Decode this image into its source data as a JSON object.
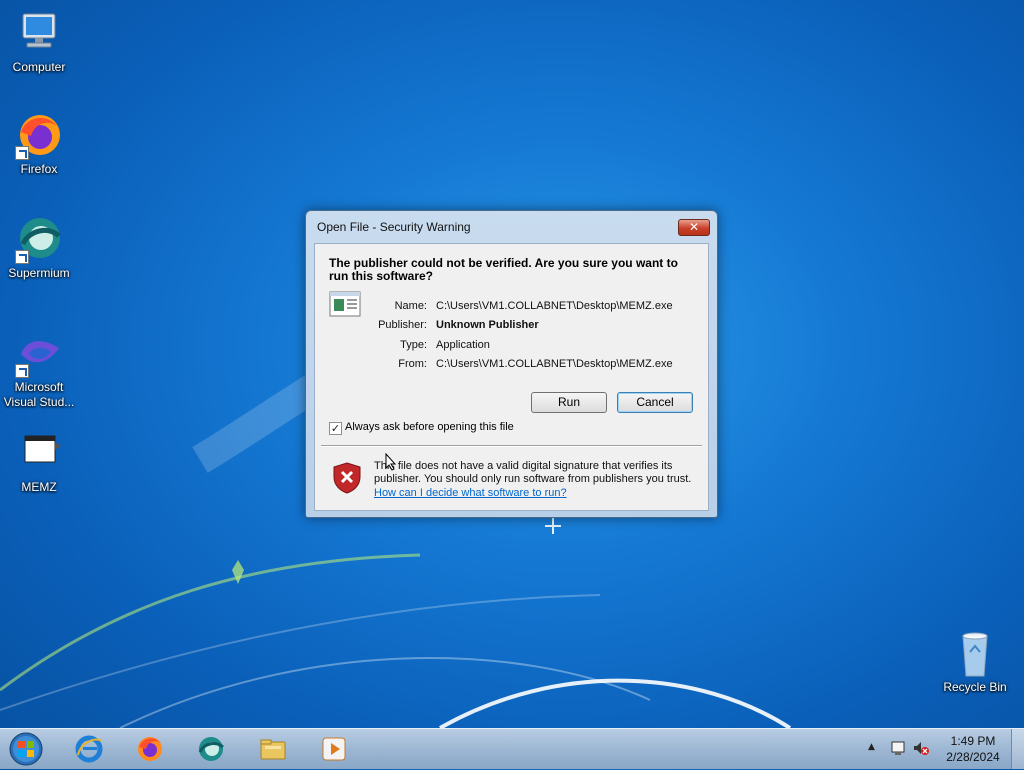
{
  "desktop": {
    "icons": [
      {
        "label": "Computer",
        "icon": "computer-icon"
      },
      {
        "label": "Firefox",
        "icon": "firefox-icon"
      },
      {
        "label": "Supermium",
        "icon": "supermium-icon"
      },
      {
        "label_line1": "Microsoft",
        "label_line2": "Visual Stud...",
        "icon": "visual-studio-icon"
      },
      {
        "label": "MEMZ",
        "icon": "memz-icon"
      },
      {
        "label": "Recycle Bin",
        "icon": "recycle-bin-icon"
      }
    ]
  },
  "dialog": {
    "title": "Open File - Security Warning",
    "close_label": "✕",
    "headline": "The publisher could not be verified.  Are you sure you want to run this software?",
    "fields": {
      "name_label": "Name:",
      "name_value": "C:\\Users\\VM1.COLLABNET\\Desktop\\MEMZ.exe",
      "publisher_label": "Publisher:",
      "publisher_value": "Unknown Publisher",
      "type_label": "Type:",
      "type_value": "Application",
      "from_label": "From:",
      "from_value": "C:\\Users\\VM1.COLLABNET\\Desktop\\MEMZ.exe"
    },
    "run_label": "Run",
    "cancel_label": "Cancel",
    "checkbox_label": "Always ask before opening this file",
    "checkbox_checked": true,
    "checkbox_mark": "✓",
    "warning_text": "This file does not have a valid digital signature that verifies its publisher.  You should only run software from publishers you trust.",
    "help_link": "How can I decide what software to run?"
  },
  "taskbar": {
    "items": [
      "start-orb-icon",
      "internet-explorer-icon",
      "firefox-icon",
      "supermium-icon",
      "file-explorer-icon",
      "media-player-icon"
    ],
    "tray_arrow": "▲",
    "time": "1:49 PM",
    "date": "2/28/2024"
  },
  "colors": {
    "desktop_blue": "#1579d4",
    "link": "#0066cc",
    "close_red": "#c8412a"
  }
}
